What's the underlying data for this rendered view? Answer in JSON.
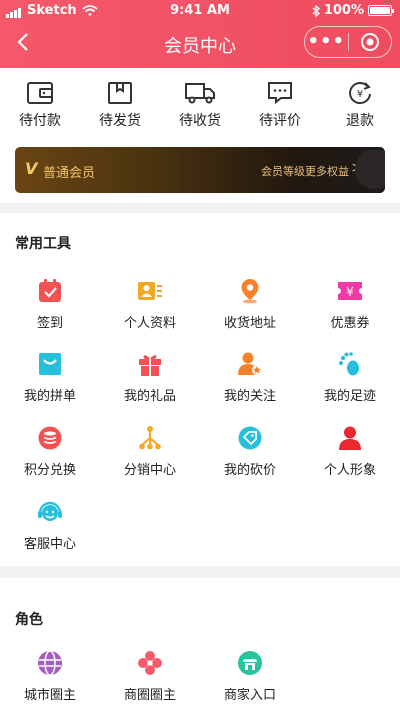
{
  "status_bar": {
    "carrier": "Sketch",
    "time": "9:41 AM",
    "battery": "100%"
  },
  "nav": {
    "title": "会员中心",
    "more_label": "•••"
  },
  "orders": [
    {
      "label": "待付款",
      "icon": "wallet-icon"
    },
    {
      "label": "待发货",
      "icon": "box-icon"
    },
    {
      "label": "待收货",
      "icon": "truck-icon"
    },
    {
      "label": "待评价",
      "icon": "comment-icon"
    },
    {
      "label": "退款",
      "icon": "refund-icon"
    }
  ],
  "member_card": {
    "badge": "V",
    "level": "普通会员",
    "link": "会员等级更多权益",
    "arrow": ">"
  },
  "tools": {
    "title": "常用工具",
    "items": [
      {
        "label": "签到",
        "icon": "calendar-icon",
        "color": "#f25252"
      },
      {
        "label": "个人资料",
        "icon": "profile-card-icon",
        "color": "#f5a623"
      },
      {
        "label": "收货地址",
        "icon": "location-icon",
        "color": "#f5822a"
      },
      {
        "label": "优惠券",
        "icon": "coupon-icon",
        "color": "#ee3ba5"
      },
      {
        "label": "我的拼单",
        "icon": "shopping-bag-icon",
        "color": "#27c0dc"
      },
      {
        "label": "我的礼品",
        "icon": "gift-icon",
        "color": "#f25252"
      },
      {
        "label": "我的关注",
        "icon": "follow-user-icon",
        "color": "#f5822a"
      },
      {
        "label": "我的足迹",
        "icon": "footprint-icon",
        "color": "#27c0dc"
      },
      {
        "label": "积分兑换",
        "icon": "coins-icon",
        "color": "#f25252"
      },
      {
        "label": "分销中心",
        "icon": "share-tree-icon",
        "color": "#f5a623"
      },
      {
        "label": "我的砍价",
        "icon": "bargain-tag-icon",
        "color": "#27c0dc"
      },
      {
        "label": "个人形象",
        "icon": "avatar-icon",
        "color": "#e8292e"
      },
      {
        "label": "客服中心",
        "icon": "headset-icon",
        "color": "#27c0dc"
      }
    ]
  },
  "roles": {
    "title": "角色",
    "items": [
      {
        "label": "城市圈主",
        "icon": "city-globe-icon",
        "color": "#a35fc0"
      },
      {
        "label": "商圈圈主",
        "icon": "circle-flower-icon",
        "color": "#f45b6b"
      },
      {
        "label": "商家入口",
        "icon": "shop-icon",
        "color": "#2bc39b"
      }
    ]
  }
}
